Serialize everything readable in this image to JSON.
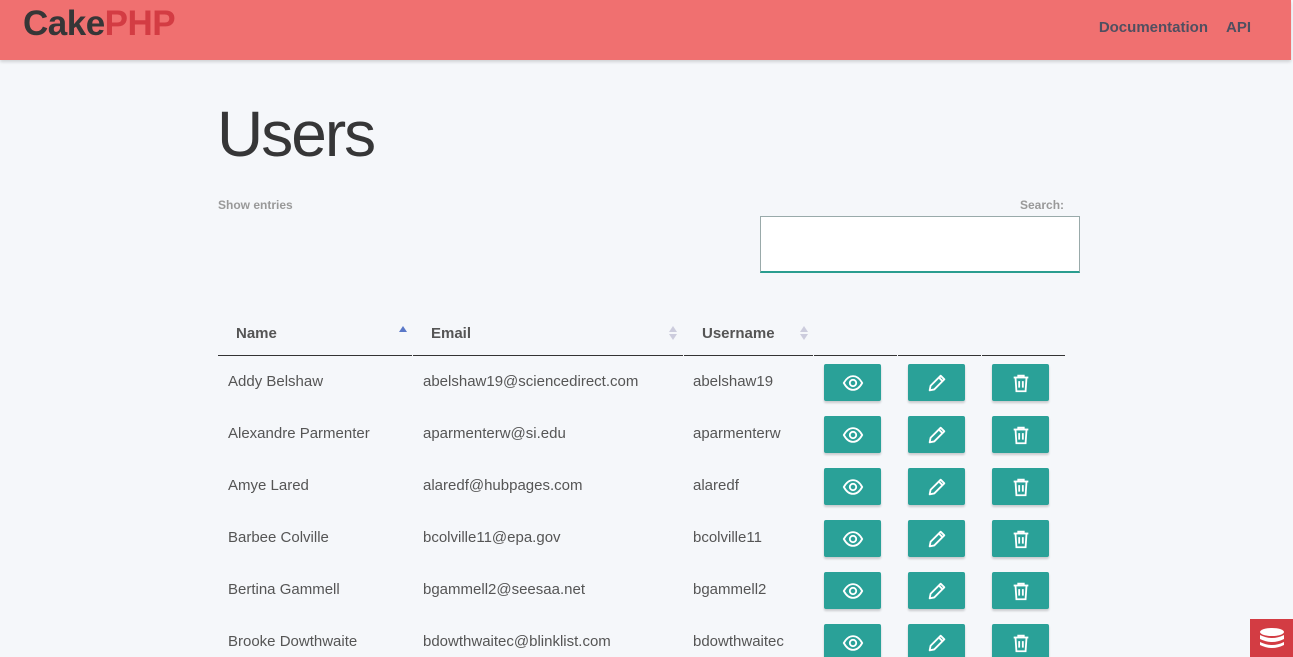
{
  "header": {
    "brand_part1": "Cake",
    "brand_part2": "PHP",
    "nav": [
      "Documentation",
      "API"
    ]
  },
  "page": {
    "title": "Users",
    "show_entries_label": "Show entries",
    "search_label": "Search:",
    "search_value": ""
  },
  "table": {
    "columns": [
      "Name",
      "Email",
      "Username"
    ],
    "sort_column": "Name",
    "sort_direction": "ascending",
    "rows": [
      {
        "name": "Addy Belshaw",
        "email": "abelshaw19@sciencedirect.com",
        "username": "abelshaw19"
      },
      {
        "name": "Alexandre Parmenter",
        "email": "aparmenterw@si.edu",
        "username": "aparmenterw"
      },
      {
        "name": "Amye Lared",
        "email": "alaredf@hubpages.com",
        "username": "alaredf"
      },
      {
        "name": "Barbee Colville",
        "email": "bcolville11@epa.gov",
        "username": "bcolville11"
      },
      {
        "name": "Bertina Gammell",
        "email": "bgammell2@seesaa.net",
        "username": "bgammell2"
      },
      {
        "name": "Brooke Dowthwaite",
        "email": "bdowthwaitec@blinklist.com",
        "username": "bdowthwaitec"
      }
    ],
    "actions": [
      "eye-icon",
      "pencil-icon",
      "trash-icon"
    ]
  },
  "colors": {
    "topbar": "#f07070",
    "brand_red": "#d33c43",
    "action_button": "#2aa198"
  }
}
